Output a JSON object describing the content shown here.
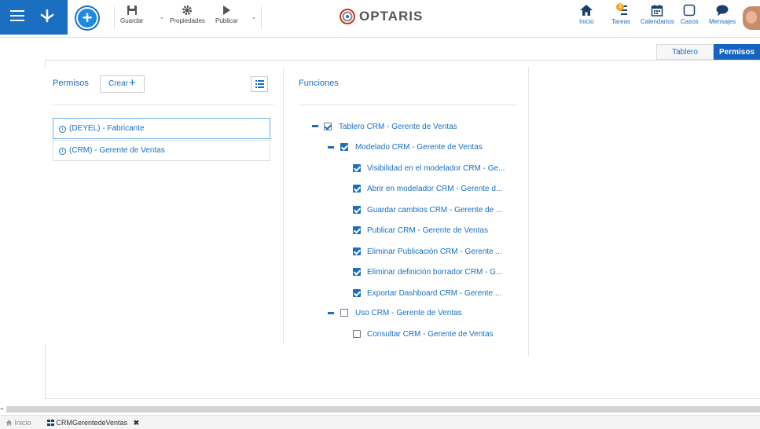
{
  "toolbar": {
    "guardar": "Guardar",
    "propiedades": "Propiedades",
    "publicar": "Publicar",
    "add_symbol": "+"
  },
  "logo": {
    "text": "OPTARIS"
  },
  "nav": {
    "inicio": "Inicio",
    "tareas": "Tareas",
    "tareas_badge": "3",
    "calendarios": "Calendarios",
    "casos": "Casos",
    "mensajes": "Mensajes"
  },
  "view_tabs": {
    "tablero": "Tablero",
    "permisos": "Permisos"
  },
  "left_panel": {
    "title": "Permisos",
    "crear_label": "Crear",
    "crear_symbol": "+",
    "info_symbol": "i",
    "items": [
      {
        "label": "(DEYEL) - Fabricante",
        "selected": true
      },
      {
        "label": "(CRM) - Gerente de Ventas",
        "selected": false
      }
    ]
  },
  "functions_panel": {
    "title": "Funciones",
    "tree": [
      {
        "label": "Tablero CRM - Gerente de Ventas",
        "level": 0,
        "checked": true,
        "expandable": true
      },
      {
        "label": "Modelado CRM - Gerente de Ventas",
        "level": 1,
        "checked": true,
        "expandable": true
      },
      {
        "label": "Visibilidad en el modelador CRM - Ge...",
        "level": 2,
        "checked": true
      },
      {
        "label": "Abrir en modelador CRM - Gerente d...",
        "level": 2,
        "checked": true
      },
      {
        "label": "Guardar cambios CRM - Gerente de ...",
        "level": 2,
        "checked": true
      },
      {
        "label": "Publicar CRM - Gerente de Ventas",
        "level": 2,
        "checked": true
      },
      {
        "label": "Eliminar Publicación CRM - Gerente ...",
        "level": 2,
        "checked": true
      },
      {
        "label": "Eliminar definición borrador CRM - G...",
        "level": 2,
        "checked": true
      },
      {
        "label": "Exportar Dashboard CRM - Gerente ...",
        "level": 2,
        "checked": true
      },
      {
        "label": "Uso CRM - Gerente de Ventas",
        "level": 1,
        "checked": false,
        "expandable": true
      },
      {
        "label": "Consultar CRM - Gerente de Ventas",
        "level": 2,
        "checked": false
      }
    ]
  },
  "bottom_tabs": {
    "inicio": "Inicio",
    "current": "CRMGerentedeVentas",
    "close_symbol": "✖"
  },
  "colors": {
    "brand_blue": "#1a6fc1",
    "header_blue": "#1565c0",
    "badge_orange": "#f5a623"
  }
}
